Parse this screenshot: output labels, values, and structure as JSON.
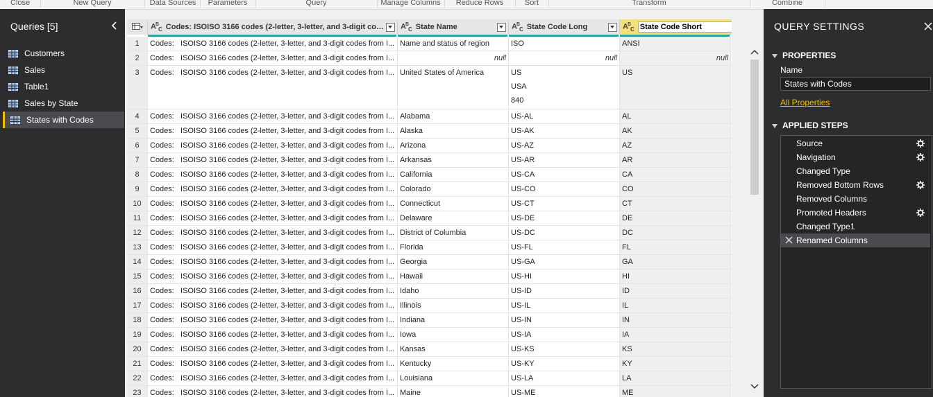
{
  "ribbon": [
    "Close",
    "New Query",
    "Data Sources",
    "Parameters",
    "Query",
    "Manage Columns",
    "Reduce Rows",
    "Sort",
    "Transform",
    "Combine"
  ],
  "queries": {
    "title": "Queries [5]",
    "items": [
      {
        "label": "Customers",
        "selected": false
      },
      {
        "label": "Sales",
        "selected": false
      },
      {
        "label": "Table1",
        "selected": false
      },
      {
        "label": "Sales by State",
        "selected": false
      },
      {
        "label": "States with Codes",
        "selected": true
      }
    ]
  },
  "columns": [
    {
      "type": "ABC",
      "name": "Codes:   ISOISO 3166 codes (2-letter, 3-letter, and 3-digit cod..."
    },
    {
      "type": "ABC",
      "name": "State Name"
    },
    {
      "type": "ABC",
      "name": "State Code Long"
    },
    {
      "type": "ABC",
      "name": "State Code Short",
      "editing": true
    }
  ],
  "codes_prefix": "Codes:",
  "codes_text": "ISOISO 3166 codes (2-letter, 3-letter, and 3-digit codes from I...",
  "null_text": "null",
  "rows": [
    {
      "n": "1",
      "name": "Name and status of region",
      "long": [
        "ISO"
      ],
      "short": "ANSI"
    },
    {
      "n": "2",
      "name": null,
      "long": null,
      "short": null
    },
    {
      "n": "3",
      "name": "United States of America",
      "long": [
        "US",
        "USA",
        "840"
      ],
      "short": "US"
    },
    {
      "n": "4",
      "name": "Alabama",
      "long": [
        "US-AL"
      ],
      "short": "AL"
    },
    {
      "n": "5",
      "name": "Alaska",
      "long": [
        "US-AK"
      ],
      "short": "AK"
    },
    {
      "n": "6",
      "name": "Arizona",
      "long": [
        "US-AZ"
      ],
      "short": "AZ"
    },
    {
      "n": "7",
      "name": "Arkansas",
      "long": [
        "US-AR"
      ],
      "short": "AR"
    },
    {
      "n": "8",
      "name": "California",
      "long": [
        "US-CA"
      ],
      "short": "CA"
    },
    {
      "n": "9",
      "name": "Colorado",
      "long": [
        "US-CO"
      ],
      "short": "CO"
    },
    {
      "n": "10",
      "name": "Connecticut",
      "long": [
        "US-CT"
      ],
      "short": "CT"
    },
    {
      "n": "11",
      "name": "Delaware",
      "long": [
        "US-DE"
      ],
      "short": "DE"
    },
    {
      "n": "12",
      "name": "District of Columbia",
      "long": [
        "US-DC"
      ],
      "short": "DC"
    },
    {
      "n": "13",
      "name": "Florida",
      "long": [
        "US-FL"
      ],
      "short": "FL"
    },
    {
      "n": "14",
      "name": "Georgia",
      "long": [
        "US-GA"
      ],
      "short": "GA"
    },
    {
      "n": "15",
      "name": "Hawaii",
      "long": [
        "US-HI"
      ],
      "short": "HI"
    },
    {
      "n": "16",
      "name": "Idaho",
      "long": [
        "US-ID"
      ],
      "short": "ID"
    },
    {
      "n": "17",
      "name": "Illinois",
      "long": [
        "US-IL"
      ],
      "short": "IL"
    },
    {
      "n": "18",
      "name": "Indiana",
      "long": [
        "US-IN"
      ],
      "short": "IN"
    },
    {
      "n": "19",
      "name": "Iowa",
      "long": [
        "US-IA"
      ],
      "short": "IA"
    },
    {
      "n": "20",
      "name": "Kansas",
      "long": [
        "US-KS"
      ],
      "short": "KS"
    },
    {
      "n": "21",
      "name": "Kentucky",
      "long": [
        "US-KY"
      ],
      "short": "KY"
    },
    {
      "n": "22",
      "name": "Louisiana",
      "long": [
        "US-LA"
      ],
      "short": "LA"
    },
    {
      "n": "23",
      "name": "Maine",
      "long": [
        "US-ME"
      ],
      "short": "ME"
    }
  ],
  "settings": {
    "title": "QUERY SETTINGS",
    "properties_header": "PROPERTIES",
    "name_label": "Name",
    "name_value": "States with Codes",
    "all_properties": "All Properties",
    "steps_header": "APPLIED STEPS",
    "steps": [
      {
        "label": "Source",
        "gear": true,
        "selected": false
      },
      {
        "label": "Navigation",
        "gear": true,
        "selected": false
      },
      {
        "label": "Changed Type",
        "gear": false,
        "selected": false
      },
      {
        "label": "Removed Bottom Rows",
        "gear": true,
        "selected": false
      },
      {
        "label": "Removed Columns",
        "gear": false,
        "selected": false
      },
      {
        "label": "Promoted Headers",
        "gear": true,
        "selected": false
      },
      {
        "label": "Changed Type1",
        "gear": false,
        "selected": false
      },
      {
        "label": "Renamed Columns",
        "gear": false,
        "selected": true
      }
    ]
  },
  "accent_color": "#f0c000",
  "header_teal": "#2ca3a3"
}
